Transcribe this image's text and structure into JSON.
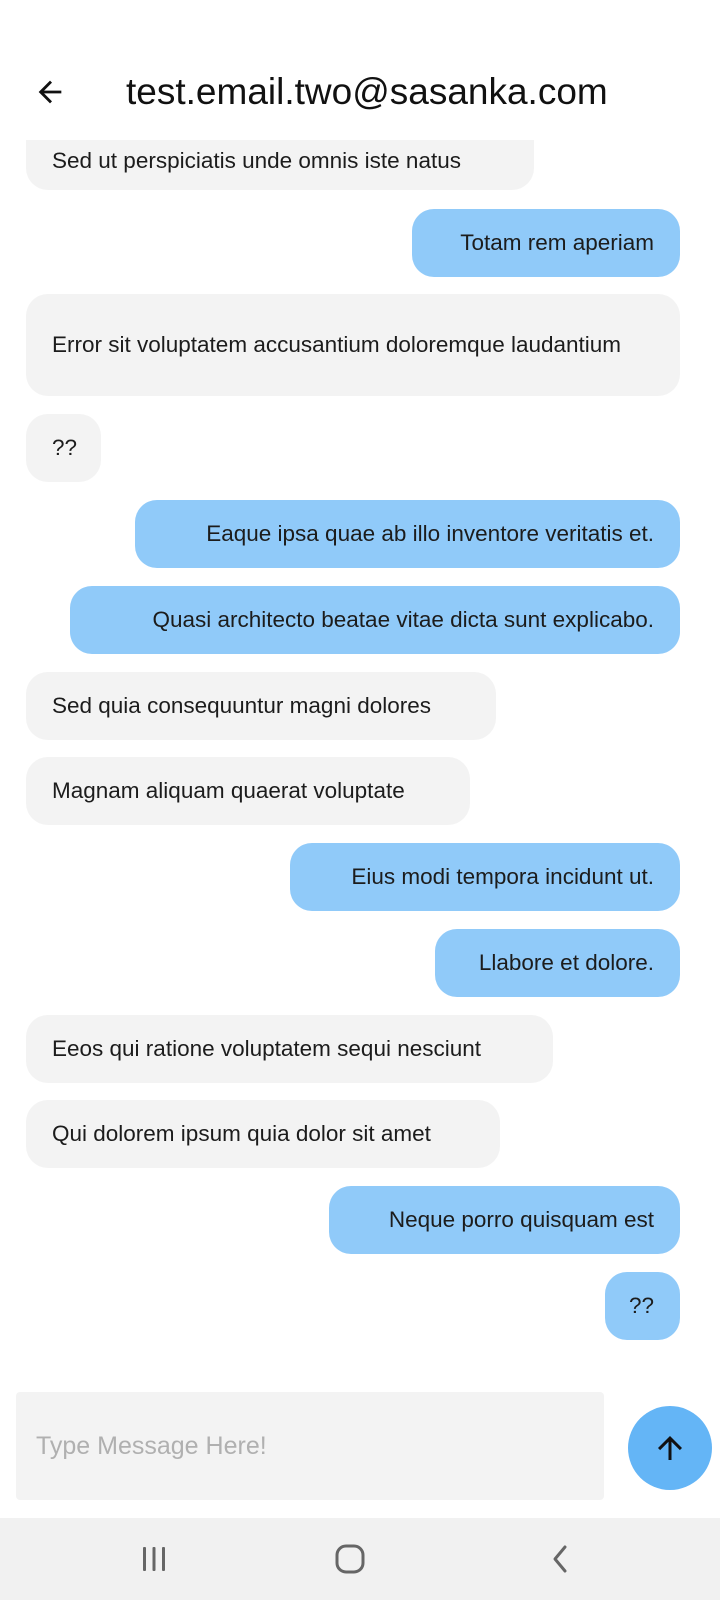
{
  "header": {
    "title": "test.email.two@sasanka.com",
    "back_icon": "arrow-left-icon"
  },
  "messages": [
    {
      "sender": "other",
      "text": "Sed ut perspiciatis unde omnis iste natus"
    },
    {
      "sender": "me",
      "text": "Totam rem aperiam"
    },
    {
      "sender": "other",
      "text": "Error sit voluptatem accusantium doloremque laudantium"
    },
    {
      "sender": "other",
      "text": "??"
    },
    {
      "sender": "me",
      "text": "Eaque ipsa quae ab illo inventore veritatis et."
    },
    {
      "sender": "me",
      "text": "Quasi architecto beatae vitae dicta sunt explicabo."
    },
    {
      "sender": "other",
      "text": "Sed quia consequuntur magni dolores"
    },
    {
      "sender": "other",
      "text": "Magnam aliquam quaerat voluptate"
    },
    {
      "sender": "me",
      "text": "Eius modi tempora incidunt ut."
    },
    {
      "sender": "me",
      "text": "Llabore et dolore."
    },
    {
      "sender": "other",
      "text": "Eeos qui ratione voluptatem sequi nesciunt"
    },
    {
      "sender": "other",
      "text": "Qui dolorem ipsum quia dolor sit amet"
    },
    {
      "sender": "me",
      "text": "Neque porro quisquam est"
    },
    {
      "sender": "me",
      "text": "??"
    }
  ],
  "composer": {
    "placeholder": "Type Message Here!",
    "value": "",
    "send_icon": "arrow-up-icon"
  },
  "navigation": {
    "recents_icon": "recents-icon",
    "home_icon": "home-icon",
    "back_icon": "back-chevron-icon"
  },
  "colors": {
    "incoming_bubble": "#f3f3f3",
    "outgoing_bubble": "#90caf9",
    "send_button": "#64b5f6",
    "nav_bar": "#f1f1f1",
    "placeholder": "#b0b0b0"
  }
}
